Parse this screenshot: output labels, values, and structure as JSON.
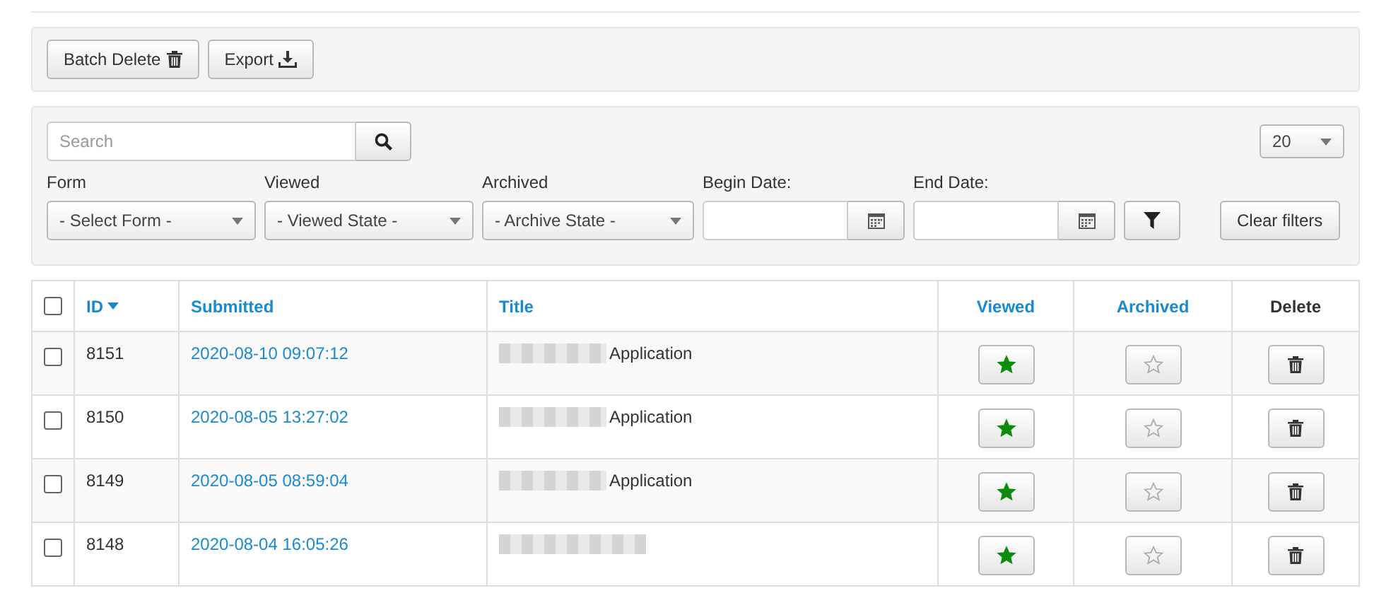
{
  "toolbar": {
    "buttons": [
      {
        "label": "Batch Delete",
        "kind": "delete"
      },
      {
        "label": "Export",
        "kind": "export"
      }
    ]
  },
  "filters": {
    "search": {
      "placeholder": "Search"
    },
    "page_size": "20",
    "selects": [
      {
        "label": "Form",
        "value": "- Select Form -"
      },
      {
        "label": "Viewed",
        "value": "- Viewed State -"
      },
      {
        "label": "Archived",
        "value": "- Archive State -"
      }
    ],
    "dates": [
      {
        "label": "Begin Date:"
      },
      {
        "label": "End Date:"
      }
    ],
    "clear_button": "Clear filters"
  },
  "table": {
    "select_all_checked": false,
    "columns": [
      {
        "label": "ID",
        "sortable": true,
        "sorted": true,
        "kind": "text"
      },
      {
        "label": "Submitted",
        "sortable": true,
        "sorted": false,
        "kind": "text"
      },
      {
        "label": "Title",
        "sortable": true,
        "sorted": false,
        "kind": "text"
      },
      {
        "label": "Viewed",
        "sortable": true,
        "sorted": false,
        "kind": "toggle"
      },
      {
        "label": "Archived",
        "sortable": true,
        "sorted": false,
        "kind": "toggle"
      },
      {
        "label": "Delete",
        "sortable": false,
        "sorted": false,
        "kind": "action"
      }
    ],
    "rows": [
      {
        "checked": false,
        "id": "8151",
        "submitted": "2020-08-10 09:07:12",
        "title": "Application",
        "viewed": true,
        "archived": false
      },
      {
        "checked": false,
        "id": "8150",
        "submitted": "2020-08-05 13:27:02",
        "title": "Application",
        "viewed": true,
        "archived": false
      },
      {
        "checked": false,
        "id": "8149",
        "submitted": "2020-08-05 08:59:04",
        "title": "Application",
        "viewed": true,
        "archived": false
      },
      {
        "checked": false,
        "id": "8148",
        "submitted": "2020-08-04 16:05:26",
        "viewed": true,
        "archived": false
      }
    ]
  }
}
